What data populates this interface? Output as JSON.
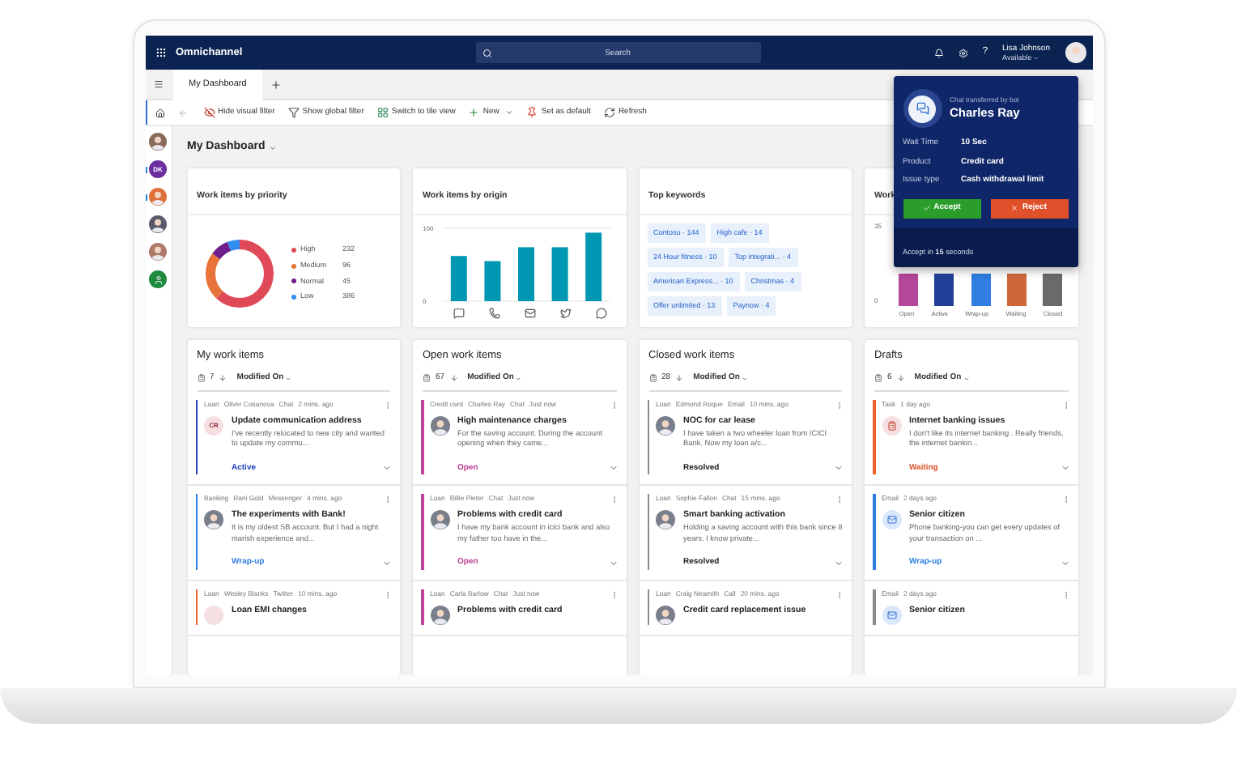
{
  "top_bar": {
    "app_name": "Omnichannel",
    "search": {
      "placeholder": "Search"
    },
    "help": "?",
    "user": {
      "name": "Lisa Johnson",
      "status": "Available"
    }
  },
  "tabs": [
    {
      "label": "My Dashboard",
      "selected": true
    }
  ],
  "toolbar": [
    {
      "kind": "hide_filter",
      "label": "Hide visual filter"
    },
    {
      "kind": "filter",
      "label": "Show global filter"
    },
    {
      "kind": "tiles",
      "label": "Switch to tile view"
    },
    {
      "kind": "new",
      "label": "New"
    },
    {
      "kind": "pin",
      "label": "Set as default"
    },
    {
      "kind": "refresh",
      "label": "Refresh"
    }
  ],
  "rail": [
    {
      "kind": "photo",
      "color": "#8a6a5a",
      "unread": false
    },
    {
      "kind": "initials",
      "initials": "DK",
      "color": "#6b2fa0",
      "unread": true
    },
    {
      "kind": "photo",
      "color": "#e0703a",
      "unread": true
    },
    {
      "kind": "photo",
      "color": "#5a5a6a",
      "unread": false
    },
    {
      "kind": "photo",
      "color": "#b07a6a",
      "unread": false
    },
    {
      "kind": "icon",
      "color": "#1e8a3e",
      "unread": false
    }
  ],
  "dashboard_title": "My Dashboard",
  "priority_card": {
    "title": "Work items by priority",
    "legend": [
      {
        "label": "High",
        "count": "232",
        "color": "#e04a58"
      },
      {
        "label": "Medium",
        "count": "96",
        "color": "#e8743a"
      },
      {
        "label": "Normal",
        "count": "45",
        "color": "#6e1f8c"
      },
      {
        "label": "Low",
        "count": "386",
        "color": "#2f8cf0"
      }
    ]
  },
  "origin_card": {
    "title": "Work items by origin",
    "origins": [
      {
        "kind": "chat"
      },
      {
        "kind": "phone"
      },
      {
        "kind": "email"
      },
      {
        "kind": "twitter"
      },
      {
        "kind": "messenger"
      }
    ],
    "chart_data": {
      "type": "bar",
      "ylim": [
        0,
        100
      ],
      "yticks": [
        0,
        100
      ],
      "series": [
        {
          "color": "#0097b2",
          "values": [
            62,
            55,
            74,
            74,
            94
          ]
        }
      ]
    }
  },
  "keywords_card": {
    "title": "Top keywords",
    "keywords": [
      "Contoso · 144",
      "High cafe · 14",
      "24 Hour fitness · 10",
      "Top integrati... · 4",
      "American Express... · 10",
      "Christmas · 4",
      "Offer unlimited · 13",
      "Paynow · 4"
    ]
  },
  "status_card": {
    "title": "Work",
    "y_labels": [
      "35",
      "0"
    ],
    "categories": [
      {
        "label": "Open",
        "color": "#b4479a"
      },
      {
        "label": "Active",
        "color": "#213f9a"
      },
      {
        "label": "Wrap-up",
        "color": "#2f7ee0"
      },
      {
        "label": "Waiting",
        "color": "#d0673a"
      },
      {
        "label": "Closed",
        "color": "#6a6a6a"
      }
    ]
  },
  "notification": {
    "caption": "Chat transferred by bot",
    "name": "Charles Ray",
    "fields": [
      {
        "label": "Wait Time",
        "value": "10 Sec"
      },
      {
        "label": "Product",
        "value": "Credit card"
      },
      {
        "label": "Issue type",
        "value": "Cash withdrawal limit"
      }
    ],
    "accept": "Accept",
    "reject": "Reject",
    "footer": "Accept in **15** seconds"
  },
  "columns": [
    {
      "title": "My work items",
      "count": "7",
      "sort": "Modified On",
      "items": [
        {
          "meta": [
            "Loan",
            "Oliver Cosanova",
            "Chat",
            "2 mins. ago"
          ],
          "avatar": {
            "kind": "initials",
            "text": "CR"
          },
          "title": "Update communication address",
          "text": "I've recently relocated to new city and wanted to update my commu...",
          "status": "Active",
          "kind": "active",
          "color": "#2a3fb0"
        },
        {
          "meta": [
            "Banking",
            "Rani Gold",
            "Messenger",
            "4 mins. ago"
          ],
          "avatar": {
            "kind": "photo"
          },
          "title": "The experiments with Bank!",
          "text": "It is my oldest SB account. But I had a night marish experience and...",
          "status": "Wrap-up",
          "kind": "wrapup",
          "color": "#2f7ee0"
        },
        {
          "meta": [
            "Loan",
            "Wesley Blanks",
            "Twitter",
            "10 mins. ago"
          ],
          "avatar": {
            "kind": "initials_blank"
          },
          "title": "Loan EMI changes",
          "color": "#e8622a"
        }
      ]
    },
    {
      "title": "Open work items",
      "count": "67",
      "sort": "Modified On",
      "items": [
        {
          "meta": [
            "Credit card",
            "Charles Ray",
            "Chat",
            "Just now"
          ],
          "avatar": {
            "kind": "photo"
          },
          "title": "High maintenance charges",
          "text": "For the saving account. During the account opening when they came...",
          "status": "Open",
          "kind": "open",
          "color": "#c0449a"
        },
        {
          "meta": [
            "Loan",
            "Billie Pieter",
            "Chat",
            "Just now"
          ],
          "avatar": {
            "kind": "photo"
          },
          "title": "Problems with credit card",
          "text": "I have my bank account in icici bank and also my father too have in the...",
          "status": "Open",
          "kind": "open",
          "color": "#c0449a"
        },
        {
          "meta": [
            "Loan",
            "Carla Barlow",
            "Chat",
            "Just now"
          ],
          "avatar": {
            "kind": "photo"
          },
          "title": "Problems with credit card",
          "color": "#c0449a"
        }
      ]
    },
    {
      "title": "Closed work items",
      "count": "28",
      "sort": "Modified On",
      "items": [
        {
          "meta": [
            "Loan",
            "Edmond Roque",
            "Email",
            "10 mins. ago"
          ],
          "avatar": {
            "kind": "photo"
          },
          "title": "NOC for car lease",
          "text": "I have taken a two wheeler loan from ICICI Bank. Now my loan a/c...",
          "status": "Resolved",
          "kind": "resolved",
          "color": "#8a8a8a"
        },
        {
          "meta": [
            "Loan",
            "Sophie Fallon",
            "Chat",
            "15 mins. ago"
          ],
          "avatar": {
            "kind": "photo"
          },
          "title": "Smart banking activation",
          "text": "Holding a saving account with this bank since 8 years. I know private...",
          "status": "Resolved",
          "kind": "resolved",
          "color": "#8a8a8a"
        },
        {
          "meta": [
            "Loan",
            "Craig Neamith",
            "Call",
            "20 mins. ago"
          ],
          "avatar": {
            "kind": "photo"
          },
          "title": "Credit card replacement issue",
          "color": "#8a8a8a"
        }
      ]
    },
    {
      "title": "Drafts",
      "count": "6",
      "sort": "Modified On",
      "items": [
        {
          "meta": [
            "Task",
            "1 day ago"
          ],
          "avatar": {
            "kind": "task"
          },
          "title": "Internet banking issues",
          "text": "I don't like its internet banking . Really friends, the internet bankin...",
          "status": "Waiting",
          "kind": "waiting",
          "color": "#e8622a"
        },
        {
          "meta": [
            "Email",
            "2 days ago"
          ],
          "avatar": {
            "kind": "email"
          },
          "title": "Senior citizen",
          "text": "Phone banking-you can get every updates of your transaction on ...",
          "status": "Wrap-up",
          "kind": "wrapup",
          "color": "#2f7ee0"
        },
        {
          "meta": [
            "Email",
            "2 days ago"
          ],
          "avatar": {
            "kind": "email"
          },
          "title": "Senior citizen",
          "color": "#8a8a8a"
        }
      ]
    }
  ]
}
